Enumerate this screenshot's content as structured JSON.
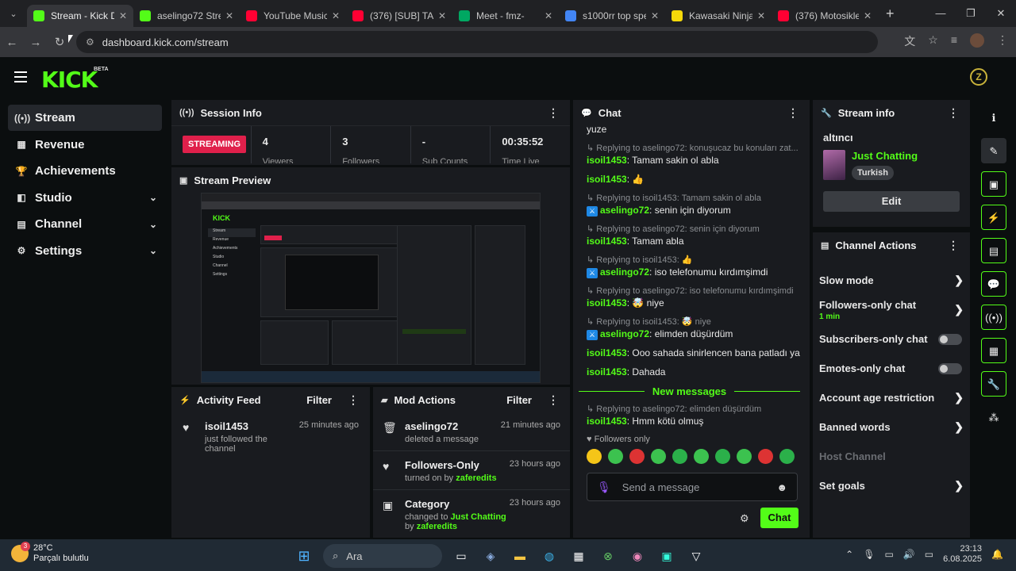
{
  "browser": {
    "tabs": [
      {
        "title": "Stream - Kick Da",
        "favicon": "kick-favicon",
        "color": "#53fc18",
        "active": true
      },
      {
        "title": "aselingo72 Strea",
        "favicon": "kick-favicon",
        "color": "#53fc18",
        "active": false
      },
      {
        "title": "YouTube Music",
        "favicon": "youtube-music-favicon",
        "color": "#ff0033",
        "active": false
      },
      {
        "title": "(376) [SUB] TAN",
        "favicon": "youtube-favicon",
        "color": "#ff0033",
        "active": false
      },
      {
        "title": "Meet - fmz-",
        "favicon": "meet-favicon",
        "color": "#00a862",
        "active": false
      },
      {
        "title": "s1000rr top spe",
        "favicon": "google-favicon",
        "color": "#4285f4",
        "active": false
      },
      {
        "title": "Kawasaki Ninja",
        "favicon": "s-favicon",
        "color": "#f5d90a",
        "active": false
      },
      {
        "title": "(376) Motosiklet",
        "favicon": "youtube-favicon",
        "color": "#ff0033",
        "active": false
      }
    ],
    "url": "dashboard.kick.com/stream"
  },
  "app": {
    "logo": "KICK",
    "beta": "BETA",
    "badge": "Z"
  },
  "sidebar": {
    "items": [
      {
        "label": "Stream",
        "icon": "broadcast-icon",
        "active": true,
        "chevron": false
      },
      {
        "label": "Revenue",
        "icon": "chart-icon",
        "active": false,
        "chevron": false
      },
      {
        "label": "Achievements",
        "icon": "trophy-icon",
        "active": false,
        "chevron": false
      },
      {
        "label": "Studio",
        "icon": "layers-icon",
        "active": false,
        "chevron": true
      },
      {
        "label": "Channel",
        "icon": "channel-icon",
        "active": false,
        "chevron": true
      },
      {
        "label": "Settings",
        "icon": "gear-icon",
        "active": false,
        "chevron": true
      }
    ]
  },
  "session": {
    "title": "Session Info",
    "status": "STREAMING",
    "stats": [
      {
        "value": "4",
        "label": "Viewers"
      },
      {
        "value": "3",
        "label": "Followers"
      },
      {
        "value": "-",
        "label": "Sub Counts"
      },
      {
        "value": "00:35:52",
        "label": "Time Live"
      }
    ]
  },
  "preview": {
    "title": "Stream Preview"
  },
  "activity": {
    "title": "Activity Feed",
    "filter": "Filter",
    "items": [
      {
        "user": "isoil1453",
        "text": "just followed the channel",
        "time": "25 minutes ago"
      }
    ]
  },
  "mod": {
    "title": "Mod Actions",
    "filter": "Filter",
    "items": [
      {
        "icon": "trash-icon",
        "title": "aselingo72",
        "line_prefix": "deleted a message",
        "line_link": "",
        "line_mid": "",
        "line_user": "",
        "time": "21 minutes ago"
      },
      {
        "icon": "heart-icon",
        "title": "Followers-Only",
        "line_prefix": "turned on by ",
        "line_link": "",
        "line_mid": "",
        "line_user": "zaferedits",
        "time": "23 hours ago"
      },
      {
        "icon": "category-icon",
        "title": "Category",
        "line_prefix": "changed to ",
        "line_link": "Just Chatting",
        "line_mid": " by ",
        "line_user": "zaferedits",
        "time": "23 hours ago"
      }
    ]
  },
  "chat": {
    "title": "Chat",
    "messages": [
      {
        "reply": "",
        "user": "",
        "mod": false,
        "text": "yuze"
      },
      {
        "reply": "Replying to aselingo72: konuşucaz bu konuları zat...",
        "user": "isoil1453",
        "mod": false,
        "text": "Tamam sakin ol abla"
      },
      {
        "reply": "",
        "user": "isoil1453",
        "mod": false,
        "text": "👍"
      },
      {
        "reply": "Replying to isoil1453: Tamam sakin ol abla",
        "user": "aselingo72",
        "mod": true,
        "text": "senin için diyorum"
      },
      {
        "reply": "Replying to aselingo72: senin için diyorum",
        "user": "isoil1453",
        "mod": false,
        "text": "Tamam abla"
      },
      {
        "reply": "Replying to isoil1453: 👍",
        "user": "aselingo72",
        "mod": true,
        "text": "iso telefonumu kırdımşimdi"
      },
      {
        "reply": "Replying to aselingo72: iso telefonumu kırdımşimdi",
        "user": "isoil1453",
        "mod": false,
        "text": "🤯 niye"
      },
      {
        "reply": "Replying to isoil1453: 🤯 niye",
        "user": "aselingo72",
        "mod": true,
        "text": "elimden düşürdüm"
      },
      {
        "reply": "",
        "user": "isoil1453",
        "mod": false,
        "text": "Ooo sahada sinirlencen bana patladı ya"
      },
      {
        "reply": "",
        "user": "isoil1453",
        "mod": false,
        "text": "Dahada"
      }
    ],
    "new_messages": "New messages",
    "after": [
      {
        "reply": "Replying to aselingo72: elimden düşürdüm",
        "user": "isoil1453",
        "mod": false,
        "text": "Hmm kötü olmuş"
      }
    ],
    "followers_only": "Followers only",
    "placeholder": "Send a message",
    "send": "Chat"
  },
  "stream_info": {
    "title": "Stream info",
    "stream_title": "altıncı",
    "category": "Just Chatting",
    "language": "Turkish",
    "edit": "Edit"
  },
  "channel_actions": {
    "title": "Channel Actions",
    "items": [
      {
        "label": "Slow mode",
        "type": "chevron",
        "sub": ""
      },
      {
        "label": "Followers-only chat",
        "type": "chevron",
        "sub": "1 min"
      },
      {
        "label": "Subscribers-only chat",
        "type": "toggle",
        "sub": ""
      },
      {
        "label": "Emotes-only chat",
        "type": "toggle",
        "sub": ""
      },
      {
        "label": "Account age restriction",
        "type": "chevron",
        "sub": ""
      },
      {
        "label": "Banned words",
        "type": "chevron",
        "sub": ""
      },
      {
        "label": "Host Channel",
        "type": "disabled",
        "sub": ""
      },
      {
        "label": "Set goals",
        "type": "chevron",
        "sub": ""
      }
    ]
  },
  "taskbar": {
    "temp": "28°C",
    "weather": "Parçalı bulutlu",
    "badge": "3",
    "search": "Ara",
    "time": "23:13",
    "date": "6.08.2025"
  },
  "colors": {
    "accent": "#53fc18",
    "live": "#e0204b",
    "panel": "#191b1f"
  }
}
